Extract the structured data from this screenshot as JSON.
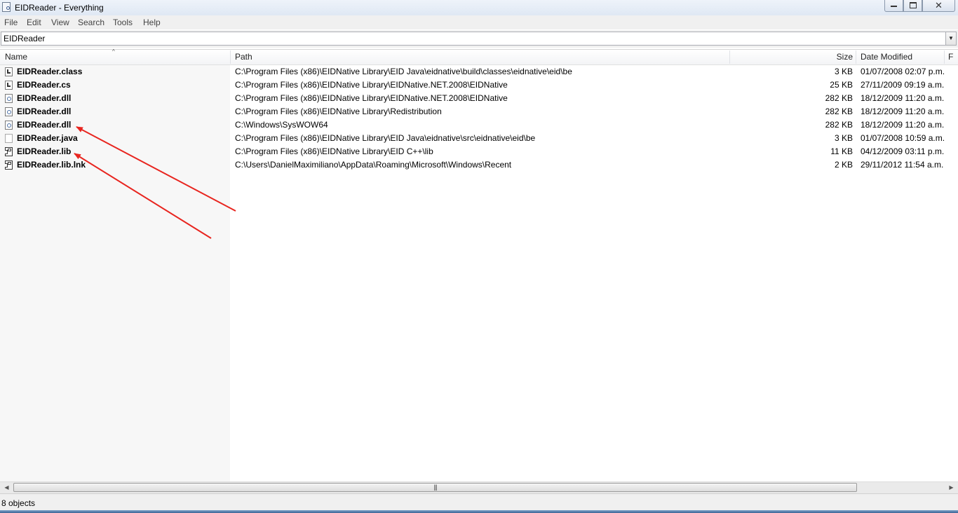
{
  "window": {
    "title": "EIDReader - Everything"
  },
  "menu": [
    "File",
    "Edit",
    "View",
    "Search",
    "Tools",
    "Help"
  ],
  "search": {
    "value": "EIDReader"
  },
  "columns": {
    "name": "Name",
    "path": "Path",
    "size": "Size",
    "date": "Date Modified",
    "extra": "F"
  },
  "rows": [
    {
      "icon": "code-file-icon",
      "name": "EIDReader.class",
      "path": "C:\\Program Files (x86)\\EIDNative Library\\EID Java\\eidnative\\build\\classes\\eidnative\\eid\\be",
      "size": "3 KB",
      "date": "01/07/2008 02:07 p.m."
    },
    {
      "icon": "code-file-icon",
      "name": "EIDReader.cs",
      "path": "C:\\Program Files (x86)\\EIDNative Library\\EIDNative.NET.2008\\EIDNative",
      "size": "25 KB",
      "date": "27/11/2009 09:19 a.m."
    },
    {
      "icon": "dll-file-icon",
      "name": "EIDReader.dll",
      "path": "C:\\Program Files (x86)\\EIDNative Library\\EIDNative.NET.2008\\EIDNative",
      "size": "282 KB",
      "date": "18/12/2009 11:20 a.m."
    },
    {
      "icon": "dll-file-icon",
      "name": "EIDReader.dll",
      "path": "C:\\Program Files (x86)\\EIDNative Library\\Redistribution",
      "size": "282 KB",
      "date": "18/12/2009 11:20 a.m."
    },
    {
      "icon": "dll-file-icon",
      "name": "EIDReader.dll",
      "path": "C:\\Windows\\SysWOW64",
      "size": "282 KB",
      "date": "18/12/2009 11:20 a.m."
    },
    {
      "icon": "blank-file-icon",
      "name": "EIDReader.java",
      "path": "C:\\Program Files (x86)\\EIDNative Library\\EID Java\\eidnative\\src\\eidnative\\eid\\be",
      "size": "3 KB",
      "date": "01/07/2008 10:59 a.m."
    },
    {
      "icon": "lib-file-icon",
      "name": "EIDReader.lib",
      "path": "C:\\Program Files (x86)\\EIDNative Library\\EID C++\\lib",
      "size": "11 KB",
      "date": "04/12/2009 03:11 p.m."
    },
    {
      "icon": "shortcut-file-icon",
      "name": "EIDReader.lib.lnk",
      "path": "C:\\Users\\DanielMaximiliano\\AppData\\Roaming\\Microsoft\\Windows\\Recent",
      "size": "2 KB",
      "date": "29/11/2012 11:54 a.m."
    }
  ],
  "status": {
    "text": "8 objects"
  },
  "colors": {
    "annotation_arrow": "#e8251f"
  }
}
